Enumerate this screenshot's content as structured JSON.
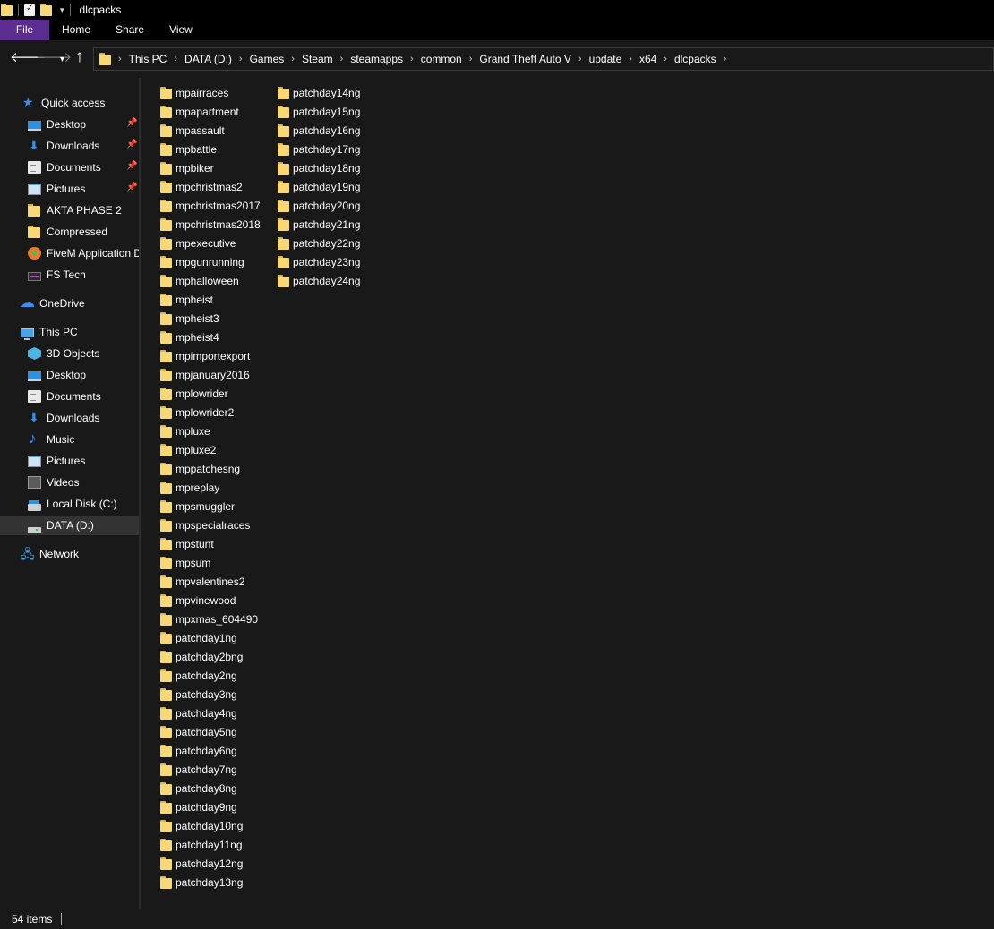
{
  "window": {
    "title": "dlcpacks"
  },
  "ribbon": {
    "tabs": [
      "File",
      "Home",
      "Share",
      "View"
    ]
  },
  "address": {
    "crumbs": [
      "This PC",
      "DATA (D:)",
      "Games",
      "Steam",
      "steamapps",
      "common",
      "Grand Theft Auto V",
      "update",
      "x64",
      "dlcpacks"
    ]
  },
  "sidebar": {
    "quick_access": "Quick access",
    "quick_items": [
      {
        "label": "Desktop",
        "icon": "desktop-icon",
        "pinned": true
      },
      {
        "label": "Downloads",
        "icon": "downloads-icon",
        "pinned": true
      },
      {
        "label": "Documents",
        "icon": "documents-icon",
        "pinned": true
      },
      {
        "label": "Pictures",
        "icon": "pictures-icon",
        "pinned": true
      },
      {
        "label": "AKTA PHASE 2",
        "icon": "folder-icon",
        "pinned": false
      },
      {
        "label": "Compressed",
        "icon": "folder-icon",
        "pinned": false
      },
      {
        "label": "FiveM Application D",
        "icon": "fivem-icon",
        "pinned": false
      },
      {
        "label": "FS Tech",
        "icon": "fs-tech-icon",
        "pinned": false
      }
    ],
    "onedrive": "OneDrive",
    "this_pc": "This PC",
    "pc_items": [
      {
        "label": "3D Objects",
        "icon": "3d-objects-icon"
      },
      {
        "label": "Desktop",
        "icon": "desktop-icon"
      },
      {
        "label": "Documents",
        "icon": "documents-icon"
      },
      {
        "label": "Downloads",
        "icon": "downloads-icon"
      },
      {
        "label": "Music",
        "icon": "music-icon"
      },
      {
        "label": "Pictures",
        "icon": "pictures-icon"
      },
      {
        "label": "Videos",
        "icon": "videos-icon"
      },
      {
        "label": "Local Disk (C:)",
        "icon": "local-disk-icon"
      },
      {
        "label": "DATA (D:)",
        "icon": "drive-icon",
        "selected": true
      }
    ],
    "network": "Network"
  },
  "files": {
    "column1": [
      "mpairraces",
      "mpapartment",
      "mpassault",
      "mpbattle",
      "mpbiker",
      "mpchristmas2",
      "mpchristmas2017",
      "mpchristmas2018",
      "mpexecutive",
      "mpgunrunning",
      "mphalloween",
      "mpheist",
      "mpheist3",
      "mpheist4",
      "mpimportexport",
      "mpjanuary2016",
      "mplowrider",
      "mplowrider2",
      "mpluxe",
      "mpluxe2",
      "mppatchesng",
      "mpreplay",
      "mpsmuggler",
      "mpspecialraces",
      "mpstunt",
      "mpsum",
      "mpvalentines2",
      "mpvinewood",
      "mpxmas_604490",
      "patchday1ng",
      "patchday2bng",
      "patchday2ng",
      "patchday3ng",
      "patchday4ng",
      "patchday5ng",
      "patchday6ng",
      "patchday7ng",
      "patchday8ng",
      "patchday9ng",
      "patchday10ng",
      "patchday11ng",
      "patchday12ng",
      "patchday13ng"
    ],
    "column2": [
      "patchday14ng",
      "patchday15ng",
      "patchday16ng",
      "patchday17ng",
      "patchday18ng",
      "patchday19ng",
      "patchday20ng",
      "patchday21ng",
      "patchday22ng",
      "patchday23ng",
      "patchday24ng"
    ]
  },
  "status": {
    "item_count": "54 items"
  },
  "colors": {
    "file_tab": "#5c2d91",
    "folder": "#f8d775",
    "background": "#191919",
    "accent_blue": "#3d8ee8"
  }
}
